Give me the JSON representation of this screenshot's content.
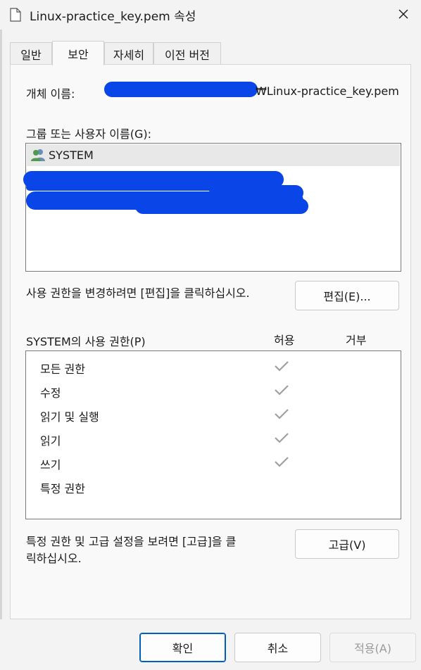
{
  "window": {
    "title": "Linux-practice_key.pem 속성",
    "close_glyph": "✕"
  },
  "tabs": [
    {
      "label": "일반"
    },
    {
      "label": "보안",
      "active": true
    },
    {
      "label": "자세히"
    },
    {
      "label": "이전 버전"
    }
  ],
  "security": {
    "object_name_label": "개체 이름:",
    "object_name_value": "₩Linux-practice_key.pem",
    "groups_label": "그룹 또는 사용자 이름(G):",
    "users": [
      {
        "name": "SYSTEM",
        "icon": "users-icon",
        "selected": true
      }
    ],
    "edit_hint": "사용 권한을 변경하려면 [편집]을 클릭하십시오.",
    "edit_button": "편집(E)...",
    "permissions_title": "SYSTEM의 사용 권한(P)",
    "allow_header": "허용",
    "deny_header": "거부",
    "permissions": [
      {
        "name": "모든 권한",
        "allow": true,
        "deny": false
      },
      {
        "name": "수정",
        "allow": true,
        "deny": false
      },
      {
        "name": "읽기 및 실행",
        "allow": true,
        "deny": false
      },
      {
        "name": "읽기",
        "allow": true,
        "deny": false
      },
      {
        "name": "쓰기",
        "allow": true,
        "deny": false
      },
      {
        "name": "특정 권한",
        "allow": false,
        "deny": false
      }
    ],
    "advanced_hint_line1": "특정 권한 및 고급 설정을 보려면 [고급]을 클",
    "advanced_hint_line2": "릭하십시오.",
    "advanced_button": "고급(V)"
  },
  "footer": {
    "ok": "확인",
    "cancel": "취소",
    "apply": "적용(A)"
  },
  "colors": {
    "accent_border": "#005fb8",
    "redaction": "#0a45e8",
    "check_gray": "#a0a0a0"
  }
}
